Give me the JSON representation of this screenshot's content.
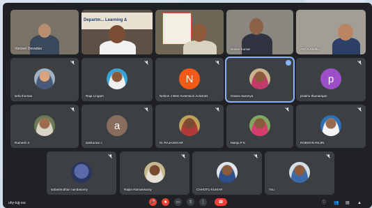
{
  "meeting": {
    "code": "uhy-tujj-our"
  },
  "top_row": [
    {
      "name": "Varuvel Devadas",
      "bg": "#7a7368"
    },
    {
      "name": "",
      "bg": "#5d5047",
      "banner": "Departm... Learning &"
    },
    {
      "name": "",
      "bg": "#6f6656",
      "banner": ""
    },
    {
      "name": "Sohan Kumar",
      "bg": "#8a8781"
    },
    {
      "name": "ASCA Sridhu",
      "bg": "#a29e96"
    }
  ],
  "row2": [
    {
      "name": "sirfa thomas",
      "kind": "photo"
    },
    {
      "name": "Raja Lingam",
      "kind": "photo"
    },
    {
      "name": "Nelson J BNC Extension Activities",
      "kind": "letter",
      "letter": "N",
      "color": "#f25a1a"
    },
    {
      "name": "Gnana Saranya",
      "kind": "photo",
      "selected": true
    },
    {
      "name": "prabhu thumarajan",
      "kind": "letter",
      "letter": "p",
      "color": "#9c4fc8"
    }
  ],
  "row3": [
    {
      "name": "Ramesh S",
      "kind": "photo"
    },
    {
      "name": "sankumar c",
      "kind": "letter",
      "letter": "a",
      "color": "#8a6c5e"
    },
    {
      "name": "M. RAJASEKAR",
      "kind": "photo"
    },
    {
      "name": "Manju P K",
      "kind": "photo"
    },
    {
      "name": "ROBSON REJIN",
      "kind": "photo"
    }
  ],
  "row4": [
    {
      "name": "sabarimuthan nandasamy",
      "kind": "photo"
    },
    {
      "name": "Rajan Ramaswamy",
      "kind": "photo"
    },
    {
      "name": "CHHOTU KUMAR",
      "kind": "photo"
    },
    {
      "name": "You",
      "kind": "photo"
    }
  ],
  "controls": [
    "mic-off",
    "camera-off",
    "captions",
    "present",
    "more",
    "end-call"
  ],
  "right_controls": [
    "info",
    "people",
    "chat",
    "activities"
  ],
  "icon_glyphs": {
    "mic-off": "🎤",
    "camera-off": "■",
    "captions": "▭",
    "present": "⇧",
    "more": "⋮",
    "end-call": "☎",
    "info": "ⓘ",
    "people": "👥",
    "chat": "▤",
    "activities": "▲"
  }
}
